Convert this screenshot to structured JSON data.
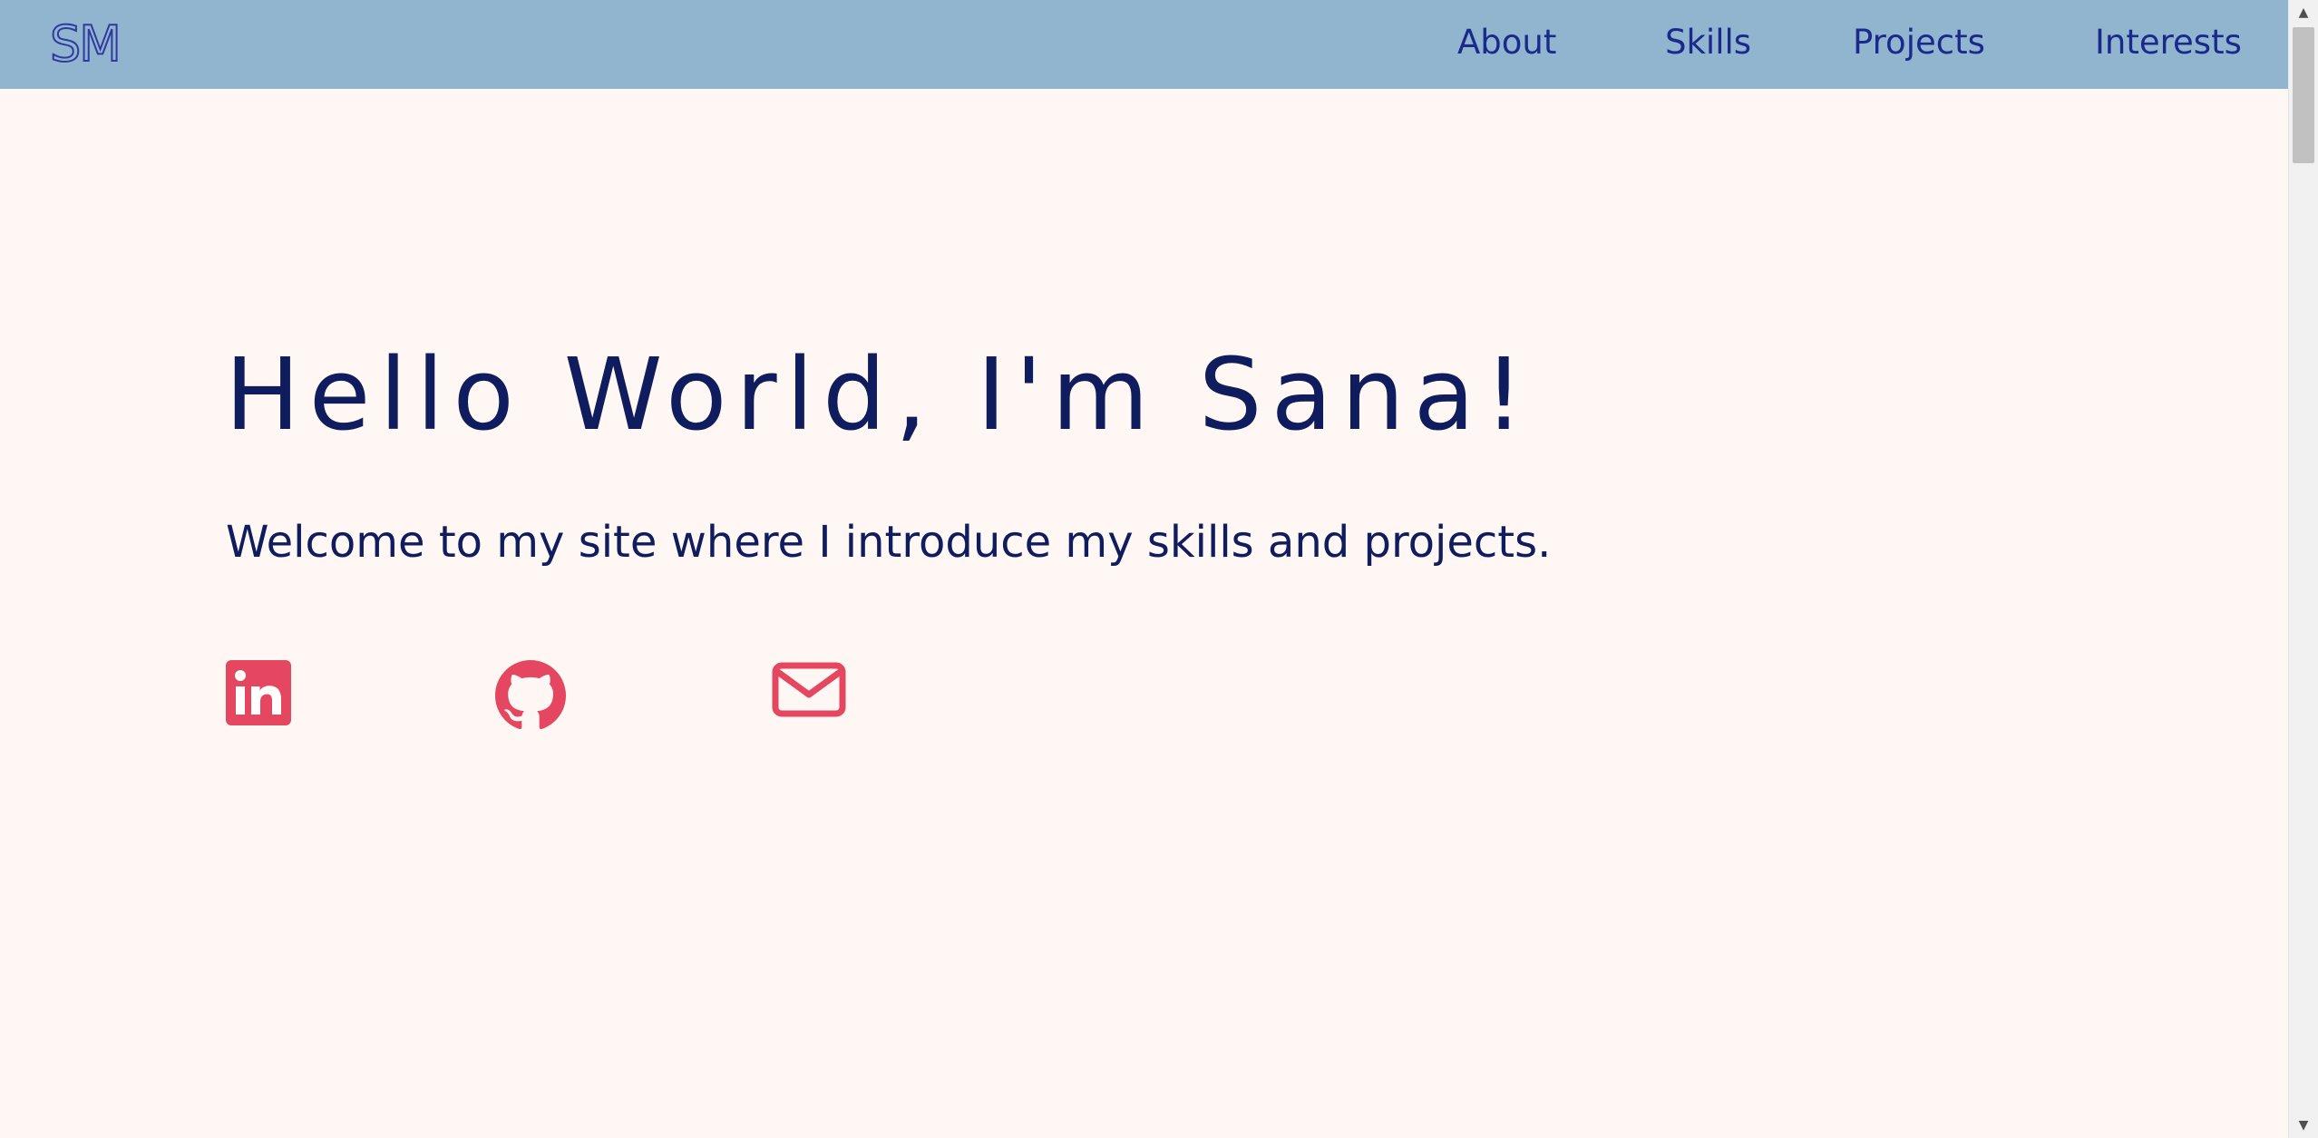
{
  "header": {
    "logo": "SM",
    "nav": {
      "about": "About",
      "skills": "Skills",
      "projects": "Projects",
      "interests": "Interests"
    }
  },
  "hero": {
    "title": "Hello World, I'm Sana!",
    "subtitle": "Welcome to my site where I introduce my skills and projects."
  },
  "social": {
    "items": [
      {
        "icon": "linkedin-icon"
      },
      {
        "icon": "github-icon"
      },
      {
        "icon": "email-icon"
      }
    ]
  },
  "colors": {
    "nav_background": "#91b4cf",
    "page_background": "#fef7f3",
    "heading_text": "#0f1c5e",
    "nav_link_text": "#1a2a8c",
    "icon_accent": "#e4475f"
  },
  "scrollbar": {
    "up_glyph": "▲",
    "down_glyph": "▼"
  }
}
